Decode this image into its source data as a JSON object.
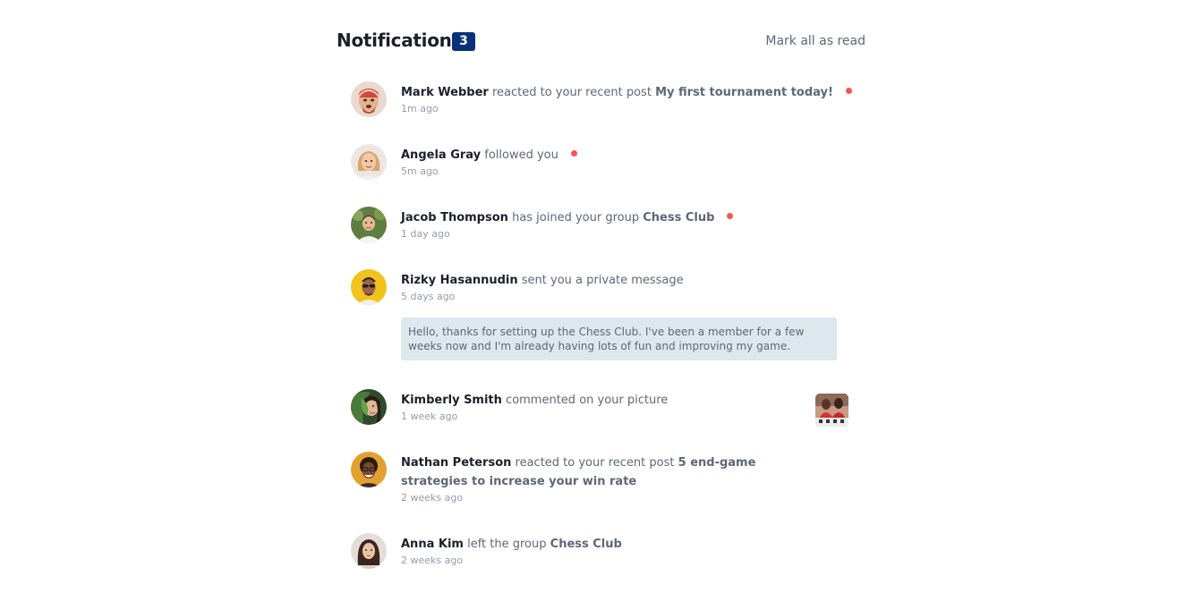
{
  "header": {
    "title": "Notification",
    "unread_count": "3",
    "mark_all_label": "Mark all as read"
  },
  "colors": {
    "badge": "#0a317b",
    "unread_dot": "#f65552",
    "message_bg": "#dde7ee",
    "name": "#1c202b",
    "text": "#5e6778",
    "time": "#939cad"
  },
  "notifications": [
    {
      "name": "Mark Webber",
      "action": "reacted to your recent post",
      "target": "My first tournament today!",
      "time": "1m ago",
      "unread": true,
      "avatar_icon": "avatar-mark-webber"
    },
    {
      "name": "Angela Gray",
      "action": "followed you",
      "target": "",
      "time": "5m ago",
      "unread": true,
      "avatar_icon": "avatar-angela-gray"
    },
    {
      "name": "Jacob Thompson",
      "action": "has joined your group",
      "target": "Chess Club",
      "time": "1 day ago",
      "unread": true,
      "avatar_icon": "avatar-jacob-thompson"
    },
    {
      "name": "Rizky Hasannudin",
      "action": "sent you a private message",
      "target": "",
      "time": "5 days ago",
      "unread": false,
      "message": "Hello, thanks for setting up the Chess Club. I've been a member for a few weeks now and I'm already having lots of fun and improving my game.",
      "avatar_icon": "avatar-rizky-hasannudin"
    },
    {
      "name": "Kimberly Smith",
      "action": "commented on your picture",
      "target": "",
      "time": "1 week ago",
      "unread": false,
      "picture_icon": "chess-picture-thumbnail",
      "avatar_icon": "avatar-kimberly-smith"
    },
    {
      "name": "Nathan Peterson",
      "action": "reacted to your recent post",
      "target": "5 end-game strategies to increase your win rate",
      "time": "2 weeks ago",
      "unread": false,
      "avatar_icon": "avatar-nathan-peterson"
    },
    {
      "name": "Anna Kim",
      "action": "left the group",
      "target": "Chess Club",
      "time": "2 weeks ago",
      "unread": false,
      "avatar_icon": "avatar-anna-kim"
    }
  ]
}
